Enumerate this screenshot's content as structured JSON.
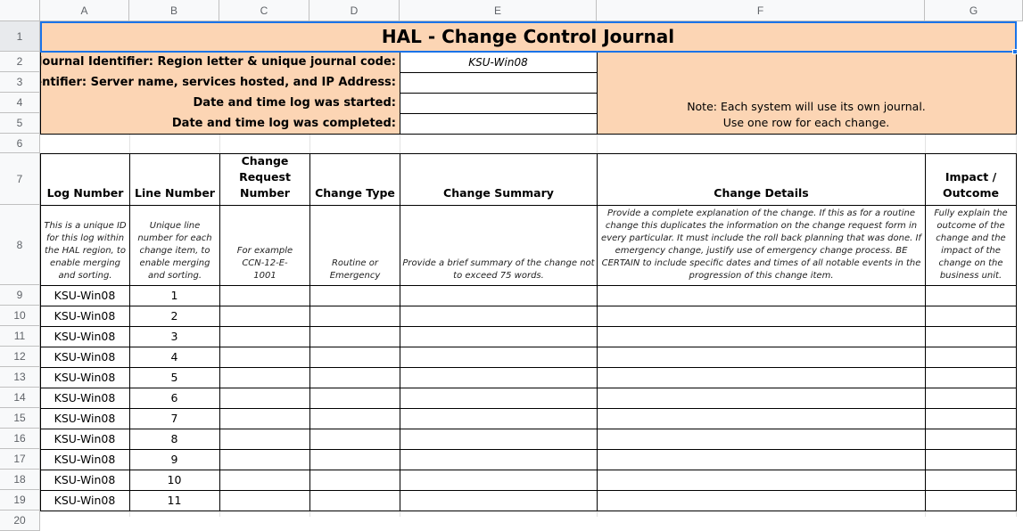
{
  "sheet": {
    "column_headers": [
      "A",
      "B",
      "C",
      "D",
      "E",
      "F",
      "G"
    ],
    "row_numbers": [
      "1",
      "2",
      "3",
      "4",
      "5",
      "6",
      "7",
      "8",
      "9",
      "10",
      "11",
      "12",
      "13",
      "14",
      "15",
      "16",
      "17",
      "18",
      "19",
      "20"
    ]
  },
  "colors": {
    "header_fill": "#fcd5b4",
    "selection": "#1a73e8"
  },
  "title": "HAL - Change Control Journal",
  "info": {
    "journal_id_label": "Journal Identifier: Region letter & unique journal code:",
    "journal_id_value": "KSU-Win08",
    "system_id_label": "System Identifier: Server name, services hosted, and IP Address:",
    "started_label": "Date and time log was started:",
    "completed_label": "Date and time log was completed:",
    "note_line1": "Note: Each system will use its own journal.",
    "note_line2": "Use one row for each change."
  },
  "columns": {
    "log_number": "Log Number",
    "line_number": "Line Number",
    "change_request_number": "Change Request Number",
    "change_type": "Change Type",
    "change_summary": "Change  Summary",
    "change_details": "Change Details",
    "impact_outcome": "Impact / Outcome"
  },
  "descriptions": {
    "log_number": "This is a unique ID for this log within the HAL region, to enable merging and sorting.",
    "line_number": "Unique line number for each change item, to enable merging and sorting.",
    "change_request_number": "For example CCN-12-E-1001",
    "change_type": "Routine or Emergency",
    "change_summary": "Provide a brief summary of the change not to exceed 75 words.",
    "change_details": "Provide a complete explanation of the change. If this as for a routine change this duplicates the information on the change request form in every particular. It must include the roll back planning that was done. If emergency change, justify use of emergency change process. BE CERTAIN to include specific dates and times of all notable events in the progression of this change item.",
    "impact_outcome": "Fully explain the outcome of the change and the impact of the change on the business unit."
  },
  "rows": [
    {
      "log": "KSU-Win08",
      "line": "1"
    },
    {
      "log": "KSU-Win08",
      "line": "2"
    },
    {
      "log": "KSU-Win08",
      "line": "3"
    },
    {
      "log": "KSU-Win08",
      "line": "4"
    },
    {
      "log": "KSU-Win08",
      "line": "5"
    },
    {
      "log": "KSU-Win08",
      "line": "6"
    },
    {
      "log": "KSU-Win08",
      "line": "7"
    },
    {
      "log": "KSU-Win08",
      "line": "8"
    },
    {
      "log": "KSU-Win08",
      "line": "9"
    },
    {
      "log": "KSU-Win08",
      "line": "10"
    },
    {
      "log": "KSU-Win08",
      "line": "11"
    }
  ]
}
